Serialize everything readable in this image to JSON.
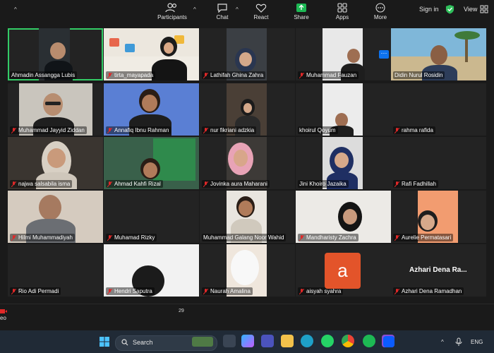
{
  "header": {
    "sign_in": "Sign in",
    "view": "View"
  },
  "participants_tiles": [
    "Ahmadin Assangga Lubis",
    "tirta_mayapada",
    "Lathifah Ghina Zahra",
    "Muhammad Fauzan",
    "Didin Nurul Rosidin",
    "Muhammad Jayyid Ziddan",
    "Annafiq Ibnu Rahman",
    "nur fikriani adzkia",
    "khoirul Qoyum",
    "rahma rafida",
    "najwa salsabila isma",
    "Ahmad Kahfi Rizal",
    "Jovinka aura Maharani",
    "Jini Khoiro Jazaika",
    "Rafi Fadhillah",
    "Hilmi Muhammadiyah",
    "Muhamad Rizky",
    "Muhammad Galang Noor Wahid",
    "Mandharisty Zachra",
    "Aurelie Permatasari",
    "Rio Adi Permadi",
    "Hendri Saputra",
    "Naurah Amalina",
    "aisyah syahra",
    "Azhari Dena Ramadhan"
  ],
  "avatar_letter": "a",
  "avatar_color": "#e3542a",
  "big_name": "Azhari Dena Ra...",
  "more_label": "···",
  "toolbar": {
    "video_label": "eo",
    "participants_label": "Participants",
    "participants_count": "29",
    "chat_label": "Chat",
    "react_label": "React",
    "share_label": "Share",
    "apps_label": "Apps",
    "more_label": "More"
  },
  "taskbar": {
    "search_placeholder": "Search",
    "language": "ENG"
  },
  "colors": {
    "active_speaker": "#33cc66",
    "share_green": "#1db954",
    "accent_blue": "#0e72ed"
  }
}
